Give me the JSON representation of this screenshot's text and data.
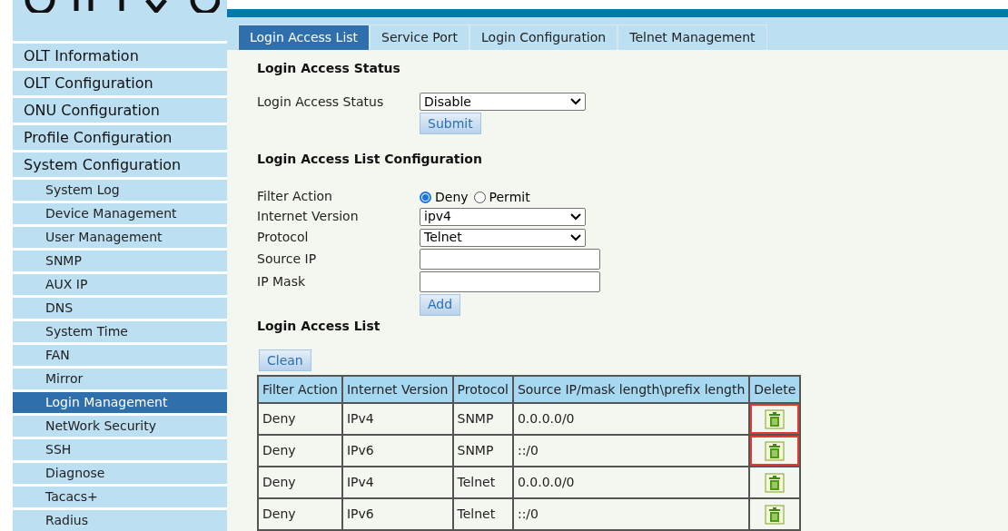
{
  "tabs": [
    {
      "label": "Login Access List",
      "selected": true
    },
    {
      "label": "Service Port",
      "selected": false
    },
    {
      "label": "Login Configuration",
      "selected": false
    },
    {
      "label": "Telnet Management",
      "selected": false
    }
  ],
  "sidebar": {
    "items": [
      {
        "label": "OLT Information",
        "selected": false
      },
      {
        "label": "OLT Configuration",
        "selected": false
      },
      {
        "label": "ONU Configuration",
        "selected": false
      },
      {
        "label": "Profile Configuration",
        "selected": false
      },
      {
        "label": "System Configuration",
        "selected": false,
        "children": [
          {
            "label": "System Log",
            "selected": false
          },
          {
            "label": "Device Management",
            "selected": false
          },
          {
            "label": "User Management",
            "selected": false
          },
          {
            "label": "SNMP",
            "selected": false
          },
          {
            "label": "AUX IP",
            "selected": false
          },
          {
            "label": "DNS",
            "selected": false
          },
          {
            "label": "System Time",
            "selected": false
          },
          {
            "label": "FAN",
            "selected": false
          },
          {
            "label": "Mirror",
            "selected": false
          },
          {
            "label": "Login Management",
            "selected": true
          },
          {
            "label": "NetWork Security",
            "selected": false
          },
          {
            "label": "SSH",
            "selected": false
          },
          {
            "label": "Diagnose",
            "selected": false
          },
          {
            "label": "Tacacs+",
            "selected": false
          },
          {
            "label": "Radius",
            "selected": false
          }
        ]
      }
    ]
  },
  "status_section": {
    "title": "Login Access Status",
    "label": "Login Access Status",
    "value": "Disable",
    "button": "Submit"
  },
  "config_section": {
    "title": "Login Access List Configuration",
    "filter_action": {
      "label": "Filter Action",
      "options": [
        {
          "label": "Deny",
          "selected": true
        },
        {
          "label": "Permit",
          "selected": false
        }
      ]
    },
    "internet_version": {
      "label": "Internet Version",
      "value": "ipv4"
    },
    "protocol": {
      "label": "Protocol",
      "value": "Telnet"
    },
    "source_ip": {
      "label": "Source IP"
    },
    "ip_mask": {
      "label": "IP Mask"
    },
    "button": "Add"
  },
  "list_section": {
    "title": "Login Access List",
    "clean_button": "Clean"
  },
  "table": {
    "columns": [
      "Filter Action",
      "Internet Version",
      "Protocol",
      "Source IP/mask length\\prefix length",
      "Delete"
    ],
    "rows": [
      {
        "cells": [
          "Deny",
          "IPv4",
          "SNMP",
          "0.0.0.0/0"
        ],
        "highlighted": true
      },
      {
        "cells": [
          "Deny",
          "IPv6",
          "SNMP",
          "::/0"
        ],
        "highlighted": true
      },
      {
        "cells": [
          "Deny",
          "IPv4",
          "Telnet",
          "0.0.0.0/0"
        ],
        "highlighted": false
      },
      {
        "cells": [
          "Deny",
          "IPv6",
          "Telnet",
          "::/0"
        ],
        "highlighted": false
      }
    ]
  }
}
